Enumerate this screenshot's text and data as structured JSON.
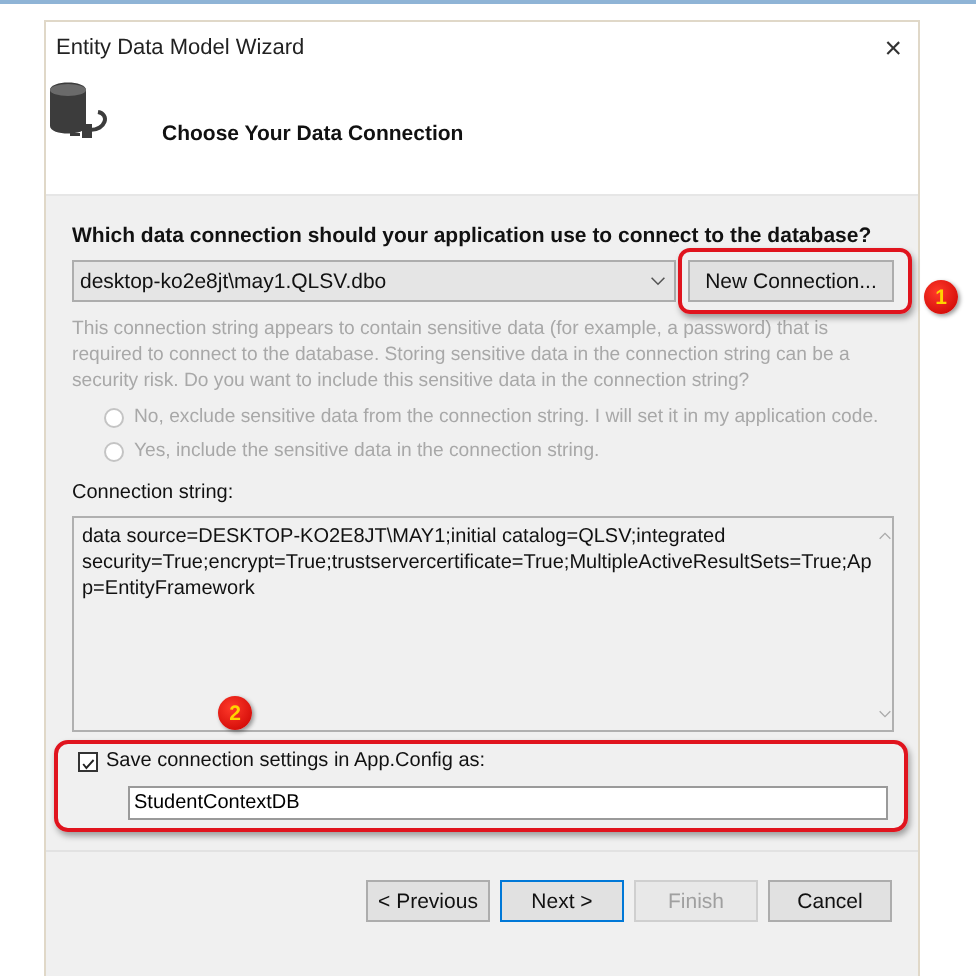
{
  "window": {
    "title": "Entity Data Model Wizard",
    "close": "×"
  },
  "header": {
    "title": "Choose Your Data Connection"
  },
  "question": "Which data connection should your application use to connect to the database?",
  "connection_select": {
    "value": "desktop-ko2e8jt\\may1.QLSV.dbo"
  },
  "new_connection_button": {
    "label": "New Connection..."
  },
  "sensitive_notice": {
    "text": "This connection string appears to contain sensitive data (for example, a password) that is required to connect to the database. Storing sensitive data in the connection string can be a security risk. Do you want to include this sensitive data in the connection string?",
    "disabled": true
  },
  "radios": [
    {
      "label": "No, exclude sensitive data from the connection string. I will set it in my application code.",
      "selected": false,
      "disabled": true
    },
    {
      "label": "Yes, include the sensitive data in the connection string.",
      "selected": false,
      "disabled": true
    }
  ],
  "connection_string": {
    "label": "Connection string:",
    "value": "data source=DESKTOP-KO2E8JT\\MAY1;initial catalog=QLSV;integrated security=True;encrypt=True;trustservercertificate=True;MultipleActiveResultSets=True;App=EntityFramework"
  },
  "save_settings": {
    "label": "Save connection settings in App.Config as:",
    "checked": true,
    "value": "StudentContextDB"
  },
  "buttons": [
    {
      "label": "< Previous",
      "disabled": false,
      "default": false
    },
    {
      "label": "Next >",
      "disabled": false,
      "default": true
    },
    {
      "label": "Finish",
      "disabled": true,
      "default": false
    },
    {
      "label": "Cancel",
      "disabled": false,
      "default": false
    }
  ],
  "annotations": [
    {
      "number": "1"
    },
    {
      "number": "2"
    }
  ]
}
